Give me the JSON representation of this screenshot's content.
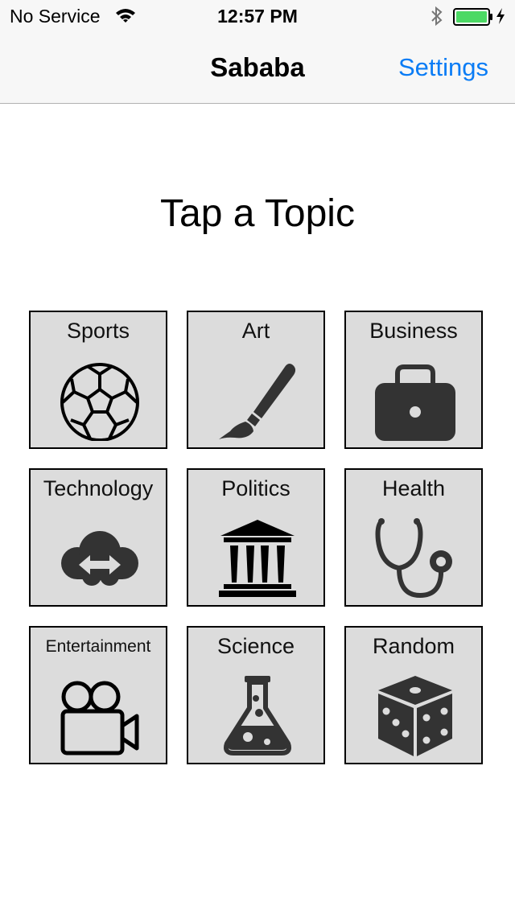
{
  "status_bar": {
    "carrier": "No Service",
    "time": "12:57 PM"
  },
  "nav": {
    "title": "Sababa",
    "settings_label": "Settings"
  },
  "prompt": "Tap a Topic",
  "topics": [
    {
      "label": "Sports",
      "icon": "soccer-ball-icon"
    },
    {
      "label": "Art",
      "icon": "paintbrush-icon"
    },
    {
      "label": "Business",
      "icon": "briefcase-icon"
    },
    {
      "label": "Technology",
      "icon": "cloud-sync-icon"
    },
    {
      "label": "Politics",
      "icon": "government-building-icon"
    },
    {
      "label": "Health",
      "icon": "stethoscope-icon"
    },
    {
      "label": "Entertainment",
      "icon": "video-camera-icon"
    },
    {
      "label": "Science",
      "icon": "flask-icon"
    },
    {
      "label": "Random",
      "icon": "dice-icon"
    }
  ],
  "colors": {
    "tile_background": "#dcdcdc",
    "accent": "#0a7cf5",
    "battery": "#4cd964"
  }
}
